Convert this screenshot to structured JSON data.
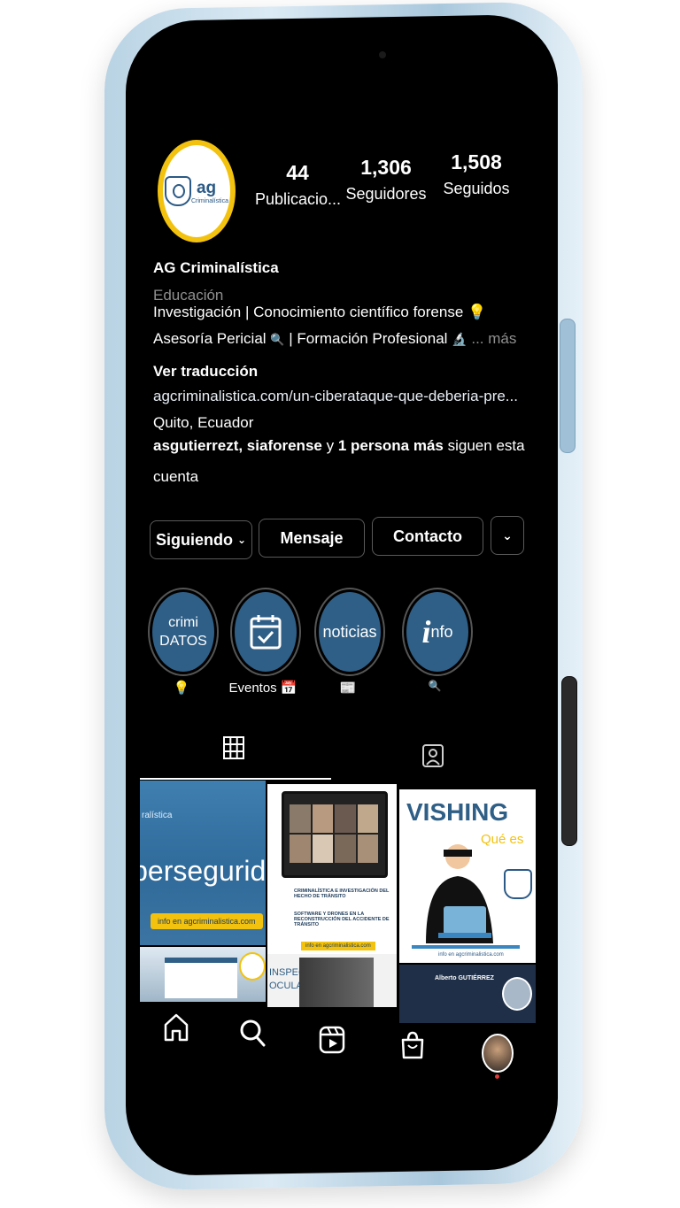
{
  "profile": {
    "stats": [
      {
        "value": "44",
        "label": "Publicacio..."
      },
      {
        "value": "1,306",
        "label": "Seguidores"
      },
      {
        "value": "1,508",
        "label": "Seguidos"
      }
    ],
    "name": "AG Criminalística",
    "category": "Educación",
    "bio_line1": "Investigación | Conocimiento científico forense",
    "bio_line2": "Asesoría Pericial",
    "bio_line2b": "| Formación Profesional",
    "more": "... más",
    "translate": "Ver traducción",
    "link": "agcriminalistica.com/un-ciberataque-que-deberia-pre...",
    "location": "Quito, Ecuador",
    "followers_bold": "asgutierrezt, siaforense",
    "followers_and": "y",
    "followers_bold2": "1 persona más",
    "followers_rest": "siguen esta",
    "followers_rest2": "cuenta"
  },
  "avatar": {
    "logo_text": "ag",
    "logo_sub": "Criminalística"
  },
  "buttons": {
    "following": "Siguiendo",
    "message": "Mensaje",
    "contact": "Contacto"
  },
  "highlights": [
    {
      "title_a": "crimi",
      "title_b": "DATOS",
      "label": "💡"
    },
    {
      "title_a": "",
      "title_b": "",
      "label": "Eventos 📅"
    },
    {
      "title_a": "noticias",
      "title_b": "",
      "label": "📰"
    },
    {
      "title_a": "i",
      "title_b": "nfo",
      "label": "🔍"
    }
  ],
  "posts": {
    "tile1_text": "ciberseguridad",
    "tile1_small": "ralística",
    "tile1_footer": "info en agcriminalistica.com",
    "tile2_line1": "CRIMINALÍSTICA E INVESTIGACIÓN DEL HECHO DE TRÁNSITO",
    "tile2_line2": "SOFTWARE Y DRONES EN LA RECONSTRUCCIÓN DEL ACCIDENTE DE TRÁNSITO",
    "tile2_footer": "info en agcriminalistica.com",
    "tile3_title": "VISHING",
    "tile3_sub": "Qué es",
    "tile3_footer": "info en agcriminalistica.com",
    "tile5_text": "INSPEC OCULAR",
    "tile6_name": "Alberto GUTIÉRREZ"
  },
  "colors": {
    "accent": "#f2c20f",
    "highlight": "#2f5f86",
    "frame": "#b9d3e4"
  }
}
